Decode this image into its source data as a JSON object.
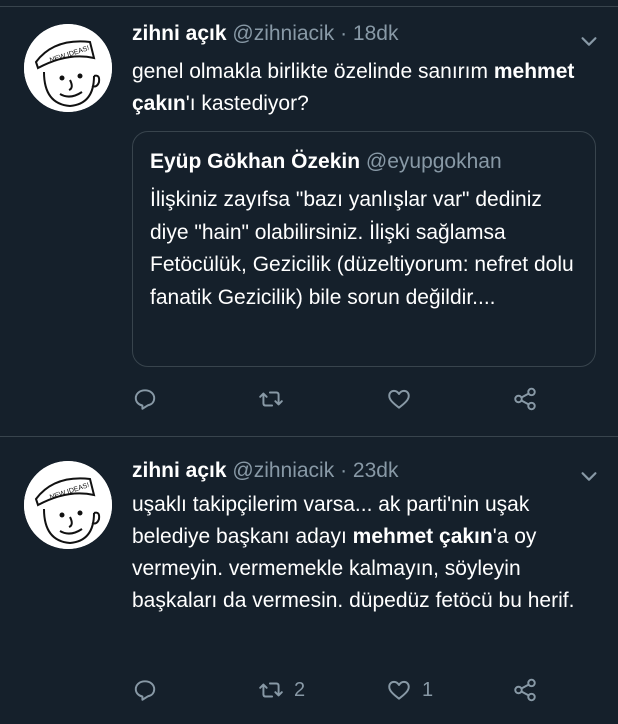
{
  "tweets": [
    {
      "name": "zihni açık",
      "handle": "@zihniacik",
      "separator": "·",
      "time": "18dk",
      "text_before": "genel olmakla birlikte özelinde sanırım ",
      "text_bold": "mehmet çakın",
      "text_after": "'ı kastediyor?",
      "avatar_caption": "NEW IDEAS!",
      "quote": {
        "name": "Eyüp Gökhan Özekin",
        "handle": "@eyupgokhan",
        "text": "İlişkiniz zayıfsa \"bazı yanlışlar var\" dediniz diye \"hain\" olabilirsiniz. İlişki sağlamsa Fetöcülük, Gezicilik (düzeltiyorum: nefret dolu fanatik Gezicilik) bile sorun değildir...."
      },
      "actions": {
        "reply_count": "",
        "retweet_count": "",
        "like_count": ""
      }
    },
    {
      "name": "zihni açık",
      "handle": "@zihniacik",
      "separator": "·",
      "time": "23dk",
      "text_before": "uşaklı takipçilerim varsa... ak parti'nin uşak belediye başkanı adayı ",
      "text_bold": "mehmet çakın",
      "text_after": "'a oy vermeyin. vermemekle kalmayın, söyleyin başkaları da vermesin. düpedüz fetöcü bu herif.",
      "avatar_caption": "NEW IDEAS!",
      "actions": {
        "reply_count": "",
        "retweet_count": "2",
        "like_count": "1"
      }
    }
  ],
  "icons": {
    "reply": "reply-icon",
    "retweet": "retweet-icon",
    "like": "heart-icon",
    "share": "share-icon",
    "more": "chevron-down-icon"
  },
  "colors": {
    "background": "#15202b",
    "secondary_text": "#8899a6",
    "divider": "#38444d",
    "text": "#ffffff"
  }
}
